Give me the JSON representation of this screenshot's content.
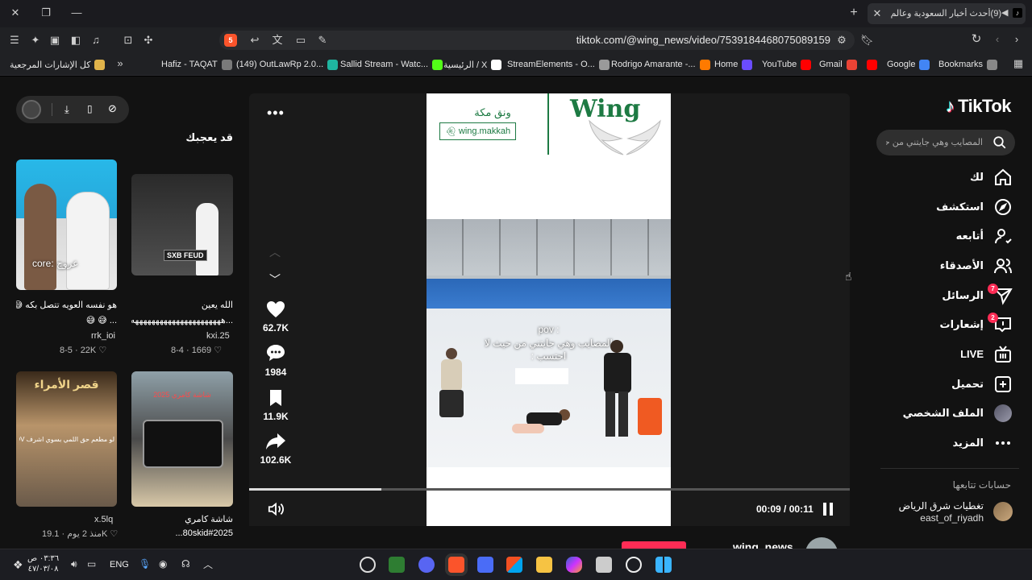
{
  "browser": {
    "tab_title": "(9)أحدث أخبار السعودية وعالم ا",
    "url": "tiktok.com/@wing_news/video/7539184468075089159",
    "shield_count": "5",
    "bookmarks": [
      {
        "label": "كل الإشارات المرجعية",
        "color": "#e0b34a"
      },
      {
        "label": "Hafiz - TAQAT",
        "color": "#7a7a7a"
      },
      {
        "label": "(149) OutLawRp 2.0...",
        "color": "#1fb5a0"
      },
      {
        "label": "Sallid Stream - Watc...",
        "color": "#53fc18"
      },
      {
        "label": "الرئيسية / X",
        "color": "#ffffff"
      },
      {
        "label": "StreamElements - O...",
        "color": "#9a9a9a"
      },
      {
        "label": "Rodrigo Amarante -...",
        "color": "#ff7a00"
      },
      {
        "label": "Home",
        "color": "#6a4cff"
      },
      {
        "label": "YouTube",
        "color": "#ff0000"
      },
      {
        "label": "Gmail",
        "color": "#ea4335"
      },
      {
        "label": "",
        "color": "#ff0000"
      },
      {
        "label": "Google",
        "color": "#4285f4"
      },
      {
        "label": "Bookmarks",
        "color": "#888888"
      }
    ]
  },
  "tiktok": {
    "logo": "TikTok",
    "search_placeholder": "المصايب وهي جايتني من حيث ...",
    "nav": [
      {
        "label": "لك",
        "icon": "home-icon"
      },
      {
        "label": "استكشف",
        "icon": "compass-icon"
      },
      {
        "label": "أتابعه",
        "icon": "user-plus-icon"
      },
      {
        "label": "الأصدقاء",
        "icon": "friends-icon"
      },
      {
        "label": "الرسائل",
        "icon": "send-icon",
        "badge": "7"
      },
      {
        "label": "إشعارات",
        "icon": "notification-icon",
        "badge": "2"
      },
      {
        "label": "LIVE",
        "icon": "live-icon"
      },
      {
        "label": "تحميل",
        "icon": "upload-icon"
      },
      {
        "label": "الملف الشخصي",
        "icon": "profile-avatar"
      },
      {
        "label": "المزيد",
        "icon": "more-icon"
      }
    ],
    "following_title": "حسابات تتابعها",
    "following": [
      {
        "name": "تغطيات شرق الرياض",
        "handle": "east_of_riyadh"
      }
    ]
  },
  "video": {
    "overlay_brand": "Wing",
    "overlay_arabic": "ونق مكة",
    "snapchat": "wing.makkah",
    "pov": "pov :",
    "subtitle_line1": "المصايب وهي جايتني من حيث لا",
    "subtitle_line2": "احتسب :",
    "time_current": "00:09",
    "time_separator": "/",
    "time_total": "00:11",
    "progress": 0.22,
    "likes": "62.7K",
    "comments": "1984",
    "saves": "11.9K",
    "shares": "102.6K",
    "author": "wing_news"
  },
  "suggestions": {
    "title": "قد يعجبك",
    "items": [
      {
        "caption": "هو نفسه العويه تتصل بكه 😅",
        "caption2": "... 😅 😅",
        "user": "rrk_ioi",
        "likes": "22K",
        "date": "8-5",
        "thumb_text": "عروج :core"
      },
      {
        "caption": "الله يعين",
        "caption2": "...ههههههههههههههههههههههه",
        "user": "kxi.25",
        "likes": "1669",
        "date": "8-4",
        "thumb_text": "SXB FEUD"
      },
      {
        "caption": "",
        "caption2": "",
        "user": "x.5lq",
        "likes": "19.1K",
        "date": "منذ 2 يوم",
        "thumb_text": "لو مطعم حق اللمي بسوي اشرف POV"
      },
      {
        "caption": "شاشة كامري",
        "caption2": "80skid#2025...",
        "user": "",
        "likes": "",
        "date": "",
        "thumb_text": "شاشة كامري 2025"
      }
    ]
  },
  "taskbar": {
    "time": "٠٣:٣٦ ص",
    "date": "٤٧/٠٣/٠٨",
    "lang": "ENG"
  }
}
